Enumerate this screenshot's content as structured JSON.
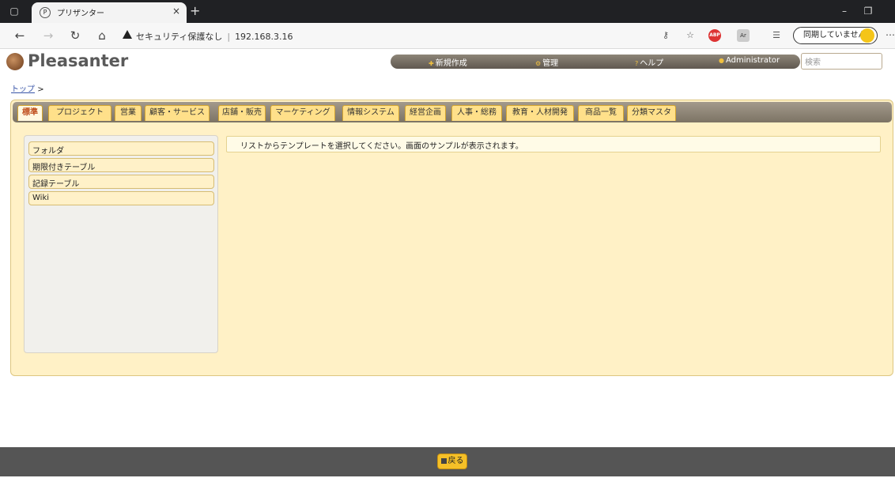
{
  "browser": {
    "tab_favicon": "P",
    "tab_title": "プリザンター",
    "tab_close": "×",
    "new_tab": "+",
    "security_label": "セキュリティ保護なし",
    "url_separator": "|",
    "url": "192.168.3.16",
    "sync_label": "同期していません",
    "abp_label": "ABP",
    "ar_label": "Ar"
  },
  "header": {
    "logo_text": "Pleasanter",
    "menu": {
      "new": "新規作成",
      "manage": "管理",
      "help": "ヘルプ",
      "user": "Administrator"
    },
    "search_placeholder": "検索"
  },
  "breadcrumb": {
    "top": "トップ",
    "separator": ">"
  },
  "tabs": [
    {
      "label": "標準",
      "active": true
    },
    {
      "label": "プロジェクト"
    },
    {
      "label": "営業"
    },
    {
      "label": "顧客・サービス"
    },
    {
      "label": "店舗・販売"
    },
    {
      "label": "マーケティング"
    },
    {
      "label": "情報システム"
    },
    {
      "label": "経営企画"
    },
    {
      "label": "人事・総務"
    },
    {
      "label": "教育・人材開発"
    },
    {
      "label": "商品一覧"
    },
    {
      "label": "分類マスタ"
    }
  ],
  "templates": [
    {
      "label": "フォルダ"
    },
    {
      "label": "期限付きテーブル"
    },
    {
      "label": "記録テーブル"
    },
    {
      "label": "Wiki"
    }
  ],
  "message": "リストからテンプレートを選択してください。画面のサンプルが表示されます。",
  "footer": {
    "back_label": "戻る"
  },
  "colors": {
    "panel_bg": "#fff1c6",
    "tab_bg": "#ffe08a",
    "footer_bg": "#555555",
    "back_button": "#f5c028"
  }
}
